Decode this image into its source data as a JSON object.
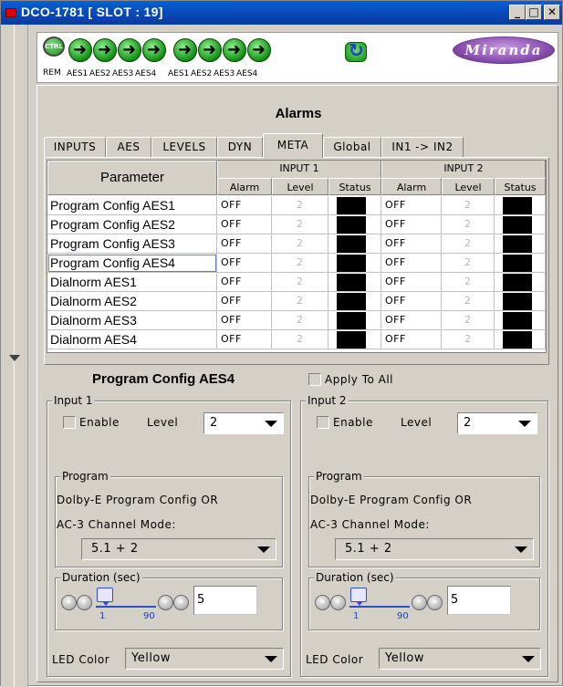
{
  "window": {
    "title": "DCO-1781 [ SLOT : 19]"
  },
  "toolbar": {
    "ctrl_label": "CTRL",
    "rem_label": "REM",
    "aes_labels": [
      "AES1",
      "AES2",
      "AES3",
      "AES4",
      "AES1",
      "AES2",
      "AES3",
      "AES4"
    ],
    "logo": "Miranda"
  },
  "page_title": "Alarms",
  "tabs": [
    {
      "label": "INPUTS"
    },
    {
      "label": "AES"
    },
    {
      "label": "LEVELS"
    },
    {
      "label": "DYN"
    },
    {
      "label": "META"
    },
    {
      "label": "Global"
    },
    {
      "label": "IN1 -> IN2"
    }
  ],
  "table": {
    "param_header": "Parameter",
    "group1": "INPUT 1",
    "group2": "INPUT 2",
    "sub_headers": [
      "Alarm",
      "Level",
      "Status"
    ],
    "rows": [
      {
        "param": "Program Config AES1",
        "alarm1": "OFF",
        "level1": "2",
        "alarm2": "OFF",
        "level2": "2"
      },
      {
        "param": "Program Config AES2",
        "alarm1": "OFF",
        "level1": "2",
        "alarm2": "OFF",
        "level2": "2"
      },
      {
        "param": "Program Config AES3",
        "alarm1": "OFF",
        "level1": "2",
        "alarm2": "OFF",
        "level2": "2"
      },
      {
        "param": "Program Config AES4",
        "alarm1": "OFF",
        "level1": "2",
        "alarm2": "OFF",
        "level2": "2"
      },
      {
        "param": "Dialnorm AES1",
        "alarm1": "OFF",
        "level1": "2",
        "alarm2": "OFF",
        "level2": "2"
      },
      {
        "param": "Dialnorm AES2",
        "alarm1": "OFF",
        "level1": "2",
        "alarm2": "OFF",
        "level2": "2"
      },
      {
        "param": "Dialnorm AES3",
        "alarm1": "OFF",
        "level1": "2",
        "alarm2": "OFF",
        "level2": "2"
      },
      {
        "param": "Dialnorm AES4",
        "alarm1": "OFF",
        "level1": "2",
        "alarm2": "OFF",
        "level2": "2"
      }
    ]
  },
  "selection": {
    "title": "Program Config AES4",
    "apply_to_all": "Apply To All"
  },
  "input1": {
    "group_label": "Input 1",
    "enable_label": "Enable",
    "level_label": "Level",
    "level_value": "2",
    "program_label": "Program",
    "program_text": "Dolby-E Program Config OR",
    "mode_label": "AC-3 Channel Mode:",
    "mode_value": "5.1 + 2",
    "duration_label": "Duration (sec)",
    "slider_min": "1",
    "slider_max": "90",
    "duration_value": "5",
    "led_label": "LED Color",
    "led_value": "Yellow"
  },
  "input2": {
    "group_label": "Input 2",
    "enable_label": "Enable",
    "level_label": "Level",
    "level_value": "2",
    "program_label": "Program",
    "program_text": "Dolby-E Program Config OR",
    "mode_label": "AC-3 Channel Mode:",
    "mode_value": "5.1 + 2",
    "duration_label": "Duration (sec)",
    "slider_min": "1",
    "slider_max": "90",
    "duration_value": "5",
    "led_label": "LED Color",
    "led_value": "Yellow"
  },
  "colors": {
    "titlebar": "#0846b4",
    "status_off": "#000000",
    "accent_purple": "#8a4fb0"
  }
}
